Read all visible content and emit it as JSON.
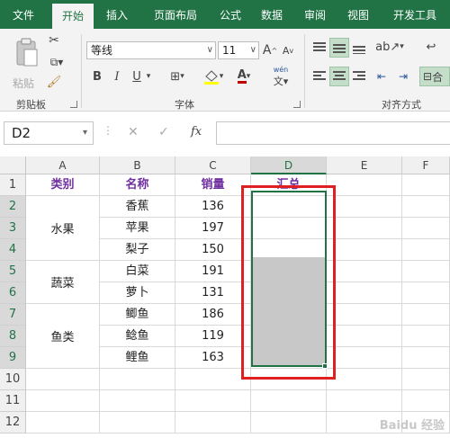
{
  "ribbon_tabs": [
    "文件",
    "开始",
    "插入",
    "页面布局",
    "公式",
    "数据",
    "审阅",
    "视图",
    "开发工具"
  ],
  "active_tab": "开始",
  "clipboard": {
    "paste_label": "粘贴",
    "group_label": "剪贴板"
  },
  "font": {
    "name": "等线",
    "size": "11",
    "bold": "B",
    "italic": "I",
    "underline": "U",
    "grow": "A",
    "shrink": "A",
    "font_color": "A",
    "phonetic": "wén",
    "group_label": "字体"
  },
  "alignment": {
    "group_label": "对齐方式",
    "partial_label": "合"
  },
  "name_box": "D2",
  "formula_icons": {
    "cancel": "✕",
    "confirm": "✓",
    "fx": "fx"
  },
  "columns": [
    "A",
    "B",
    "C",
    "D",
    "E",
    "F"
  ],
  "rows": [
    "1",
    "2",
    "3",
    "4",
    "5",
    "6",
    "7",
    "8",
    "9",
    "10",
    "11",
    "12"
  ],
  "sheet": {
    "headers": {
      "category": "类别",
      "name": "名称",
      "sales": "销量",
      "summary": "汇总"
    },
    "groups": [
      {
        "category": "水果",
        "items": [
          {
            "name": "香蕉",
            "sales": "136"
          },
          {
            "name": "苹果",
            "sales": "197"
          },
          {
            "name": "梨子",
            "sales": "150"
          }
        ]
      },
      {
        "category": "蔬菜",
        "items": [
          {
            "name": "白菜",
            "sales": "191"
          },
          {
            "name": "萝卜",
            "sales": "131"
          }
        ]
      },
      {
        "category": "鱼类",
        "items": [
          {
            "name": "鲫鱼",
            "sales": "186"
          },
          {
            "name": "鲶鱼",
            "sales": "119"
          },
          {
            "name": "鲤鱼",
            "sales": "163"
          }
        ]
      }
    ]
  },
  "watermark": "Baidu 经验",
  "colors": {
    "excel_green": "#217346",
    "header_purple": "#7030a0",
    "highlight_red": "#e02020"
  }
}
